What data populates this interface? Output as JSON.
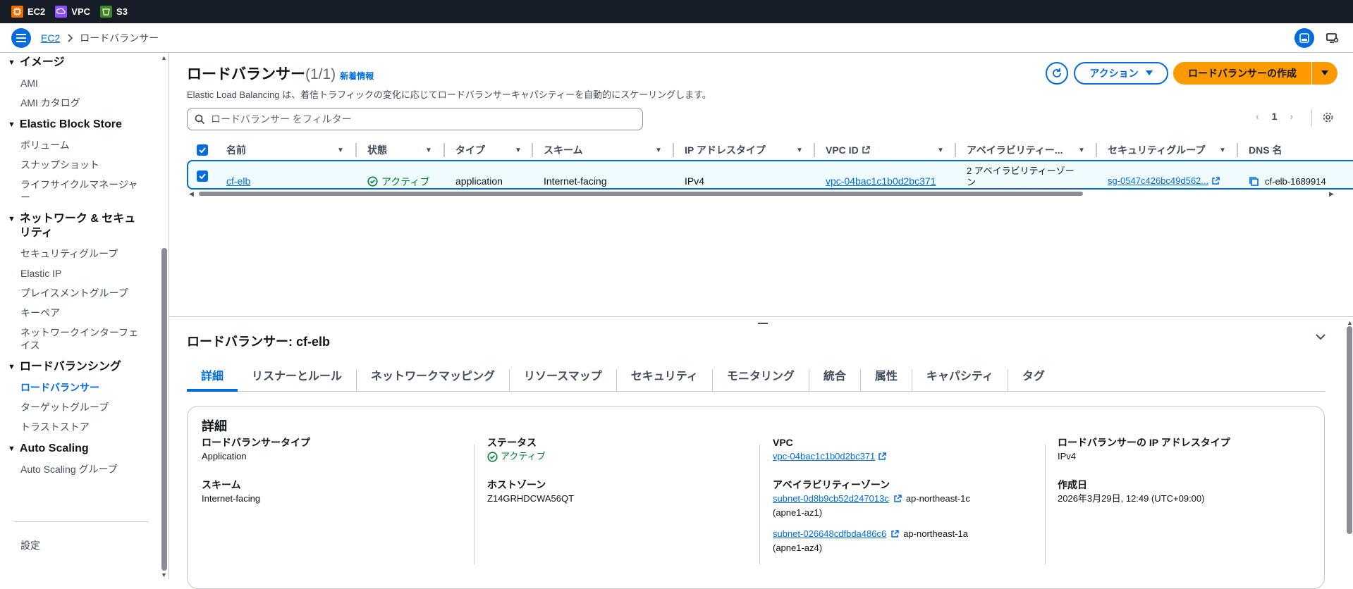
{
  "topbar": {
    "services": [
      {
        "label": "EC2",
        "color": "#ed7100",
        "icon": "ec2-icon"
      },
      {
        "label": "VPC",
        "color": "#8c4fff",
        "icon": "vpc-icon"
      },
      {
        "label": "S3",
        "color": "#3f8624",
        "icon": "s3-icon"
      }
    ]
  },
  "breadcrumb": {
    "root": "EC2",
    "current": "ロードバランサー"
  },
  "sidebar": {
    "sections": [
      {
        "title": "イメージ",
        "items": [
          "AMI",
          "AMI カタログ"
        ]
      },
      {
        "title": "Elastic Block Store",
        "items": [
          "ボリューム",
          "スナップショット",
          "ライフサイクルマネージャー"
        ]
      },
      {
        "title": "ネットワーク & セキュリティ",
        "items": [
          "セキュリティグループ",
          "Elastic IP",
          "プレイスメントグループ",
          "キーペア",
          "ネットワークインターフェイス"
        ]
      },
      {
        "title": "ロードバランシング",
        "items": [
          "ロードバランサー",
          "ターゲットグループ",
          "トラストストア"
        ]
      },
      {
        "title": "Auto Scaling",
        "items": [
          "Auto Scaling グループ"
        ]
      }
    ],
    "active": "ロードバランサー",
    "settings": "設定"
  },
  "header": {
    "title": "ロードバランサー",
    "count": "(1/1)",
    "new_info": "新着情報",
    "description": "Elastic Load Balancing は、着信トラフィックの変化に応じてロードバランサーキャパシティーを自動的にスケーリングします。",
    "actions": "アクション",
    "create": "ロードバランサーの作成",
    "filter_placeholder": "ロードバランサー をフィルター",
    "page": "1"
  },
  "table": {
    "columns": [
      "名前",
      "状態",
      "タイプ",
      "スキーム",
      "IP アドレスタイプ",
      "VPC ID",
      "アベイラビリティー...",
      "セキュリティグループ",
      "DNS 名"
    ],
    "row": {
      "name": "cf-elb",
      "state": "アクティブ",
      "type": "application",
      "scheme": "Internet-facing",
      "ip_type": "IPv4",
      "vpc": "vpc-04bac1c1b0d2bc371",
      "az_line1": "2 アベイラビリティーゾー",
      "az_line2": "ン",
      "sg": "sg-0547c426bc49d562...",
      "dns": "cf-elb-1689914"
    }
  },
  "detail": {
    "title": "ロードバランサー: cf-elb",
    "tabs": [
      "詳細",
      "リスナーとルール",
      "ネットワークマッピング",
      "リソースマップ",
      "セキュリティ",
      "モニタリング",
      "統合",
      "属性",
      "キャパシティ",
      "タグ"
    ],
    "section_title": "詳細",
    "lb_type_label": "ロードバランサータイプ",
    "lb_type": "Application",
    "scheme_label": "スキーム",
    "scheme": "Internet-facing",
    "status_label": "ステータス",
    "status": "アクティブ",
    "hosted_zone_label": "ホストゾーン",
    "hosted_zone": "Z14GRHDCWA56QT",
    "vpc_label": "VPC",
    "vpc": "vpc-04bac1c1b0d2bc371",
    "az_label": "アベイラビリティーゾーン",
    "subnet1": "subnet-0d8b9cb52d247013c",
    "subnet1_az": "ap-northeast-1c",
    "subnet1_id": "(apne1-az1)",
    "subnet2": "subnet-026648cdfbda486c6",
    "subnet2_az": "ap-northeast-1a",
    "subnet2_id": "(apne1-az4)",
    "ip_type_label": "ロードバランサーの IP アドレスタイプ",
    "ip_type": "IPv4",
    "created_label": "作成日",
    "created": "2026年3月29日, 12:49 (UTC+09:00)"
  },
  "colors": {
    "accent": "#006ce0",
    "primary_button": "#ff9900",
    "success": "#00802f",
    "topbar": "#161d26"
  }
}
